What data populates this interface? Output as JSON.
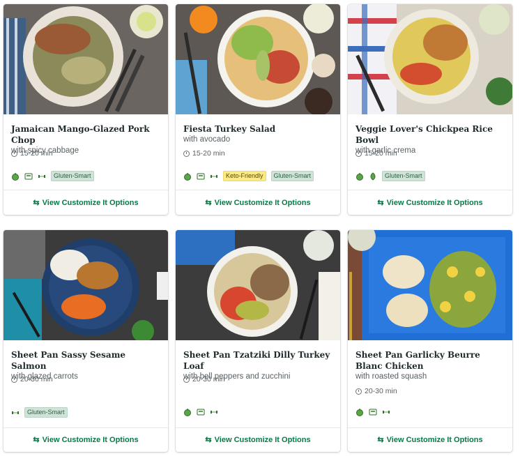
{
  "cards": [
    {
      "title": "Jamaican Mango-Glazed Pork Chop",
      "subtitle": "with spicy cabbage",
      "time": "15-20 min",
      "tags": [
        "Gluten-Smart"
      ],
      "link": "View Customize It Options"
    },
    {
      "title": "Fiesta Turkey Salad",
      "subtitle": "with avocado",
      "time": "15-20 min",
      "tags": [
        "Keto-Friendly",
        "Gluten-Smart"
      ],
      "link": "View Customize It Options"
    },
    {
      "title": "Veggie Lover's Chickpea Rice Bowl",
      "subtitle": "with garlic crema",
      "time": "15-20 min",
      "tags": [
        "Gluten-Smart"
      ],
      "link": "View Customize It Options"
    },
    {
      "title": "Sheet Pan Sassy Sesame Salmon",
      "subtitle": "with glazed carrots",
      "time": "20-30 min",
      "tags": [
        "Gluten-Smart"
      ],
      "link": "View Customize It Options"
    },
    {
      "title": "Sheet Pan Tzatziki Dilly Turkey Loaf",
      "subtitle": "with bell peppers and zucchini",
      "time": "20-30 min",
      "tags": [],
      "link": "View Customize It Options"
    },
    {
      "title": "Sheet Pan Garlicky Beurre Blanc Chicken",
      "subtitle": "with roasted squash",
      "time": "20-30 min",
      "tags": [],
      "link": "View Customize It Options"
    }
  ],
  "colors": {
    "accent": "#067a46",
    "badge_bg": "#cfe4d7",
    "keto_bg": "#fbeb86"
  },
  "icons": [
    "apple-icon",
    "calories-icon",
    "protein-icon",
    "leaf-icon",
    "customize-icon",
    "clock-icon"
  ]
}
